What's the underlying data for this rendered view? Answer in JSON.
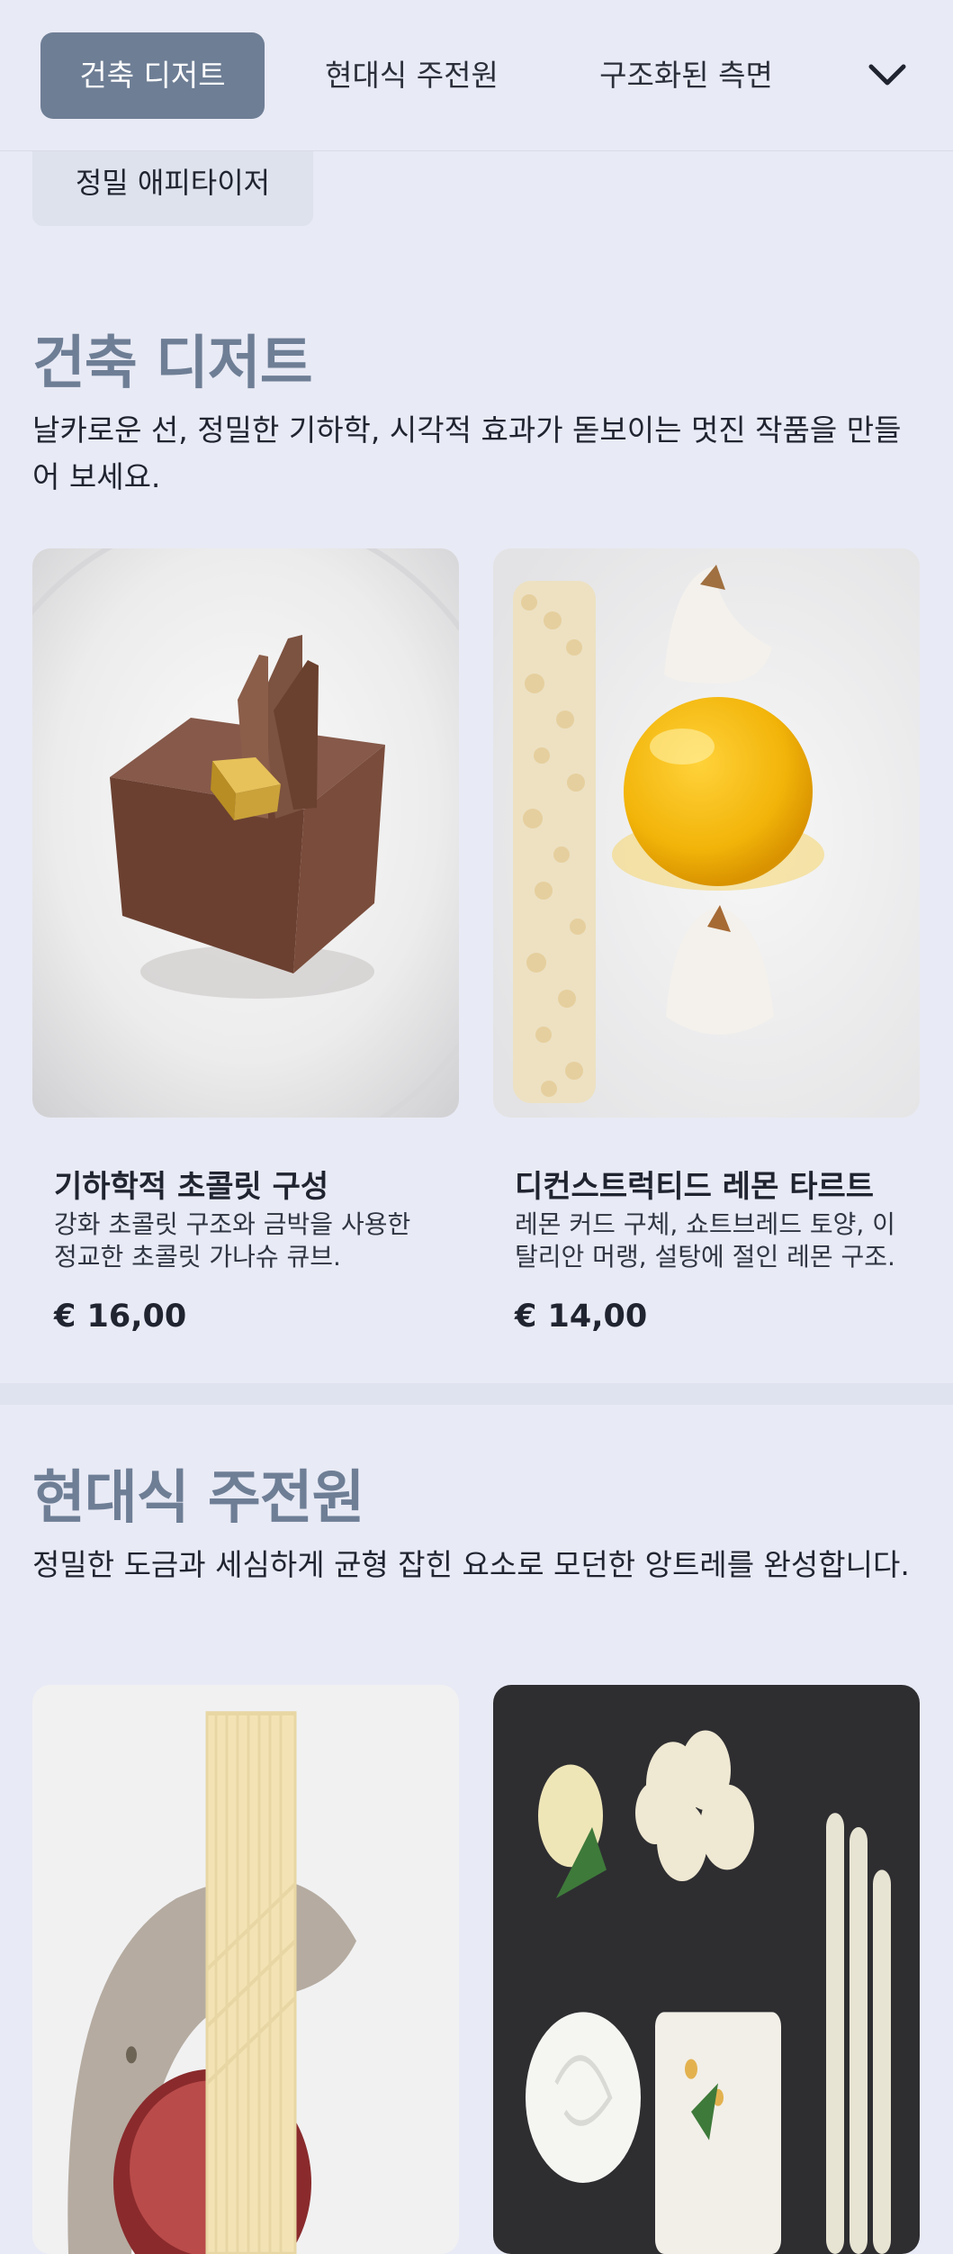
{
  "nav": {
    "tabs": [
      "건축 디저트",
      "현대식 주전원",
      "구조화된 측면"
    ],
    "active_tab": 0,
    "overflow_chip": "정밀 애피타이저",
    "expand_icon": "chevron-down-icon"
  },
  "sections": [
    {
      "title": "건축 디저트",
      "description": "날카로운 선, 정밀한 기하학, 시각적 효과가 돋보이는 멋진 작품을 만들어 보세요.",
      "items": [
        {
          "name": "기하학적 초콜릿 구성",
          "description": "강화 초콜릿 구조와 금박을 사용한 정교한 초콜릿 가나슈 큐브.",
          "price": "€ 16,00"
        },
        {
          "name": "디컨스트럭티드 레몬 타르트",
          "description": "레몬 커드 구체, 쇼트브레드 토양, 이탈리안 머랭, 설탕에 절인 레몬 구조.",
          "price": "€ 14,00"
        }
      ]
    },
    {
      "title": "현대식 주전원",
      "description": "정밀한 도금과 세심하게 균형 잡힌 요소로 모던한 앙트레를 완성합니다."
    }
  ],
  "colors": {
    "background": "#e8eaf5",
    "accent": "#6e7e95",
    "text": "#1f2430"
  }
}
